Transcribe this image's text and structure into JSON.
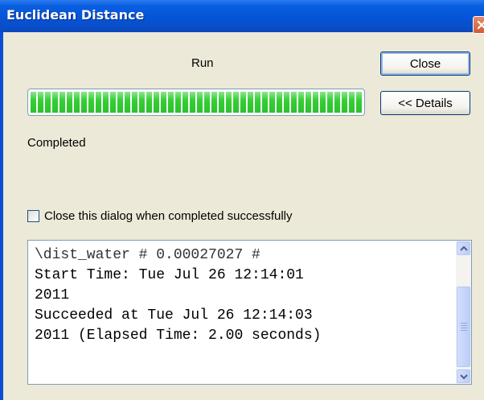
{
  "window": {
    "title": "Euclidean Distance"
  },
  "run_label": "Run",
  "buttons": {
    "close": "Close",
    "details": "<< Details"
  },
  "progress": {
    "fraction": 1.0,
    "color": "#33d033"
  },
  "status_text": "Completed",
  "checkbox": {
    "label": "Close this dialog when completed successfully",
    "checked": false
  },
  "log": {
    "lines": [
      "\\dist_water # 0.00027027 #",
      "Start Time: Tue Jul 26 12:14:01",
      "2011",
      "Succeeded at Tue Jul 26 12:14:03",
      "2011 (Elapsed Time: 2.00 seconds)"
    ]
  },
  "colors": {
    "titlebar": "#0554d8",
    "dialog_bg": "#ece9d8"
  }
}
